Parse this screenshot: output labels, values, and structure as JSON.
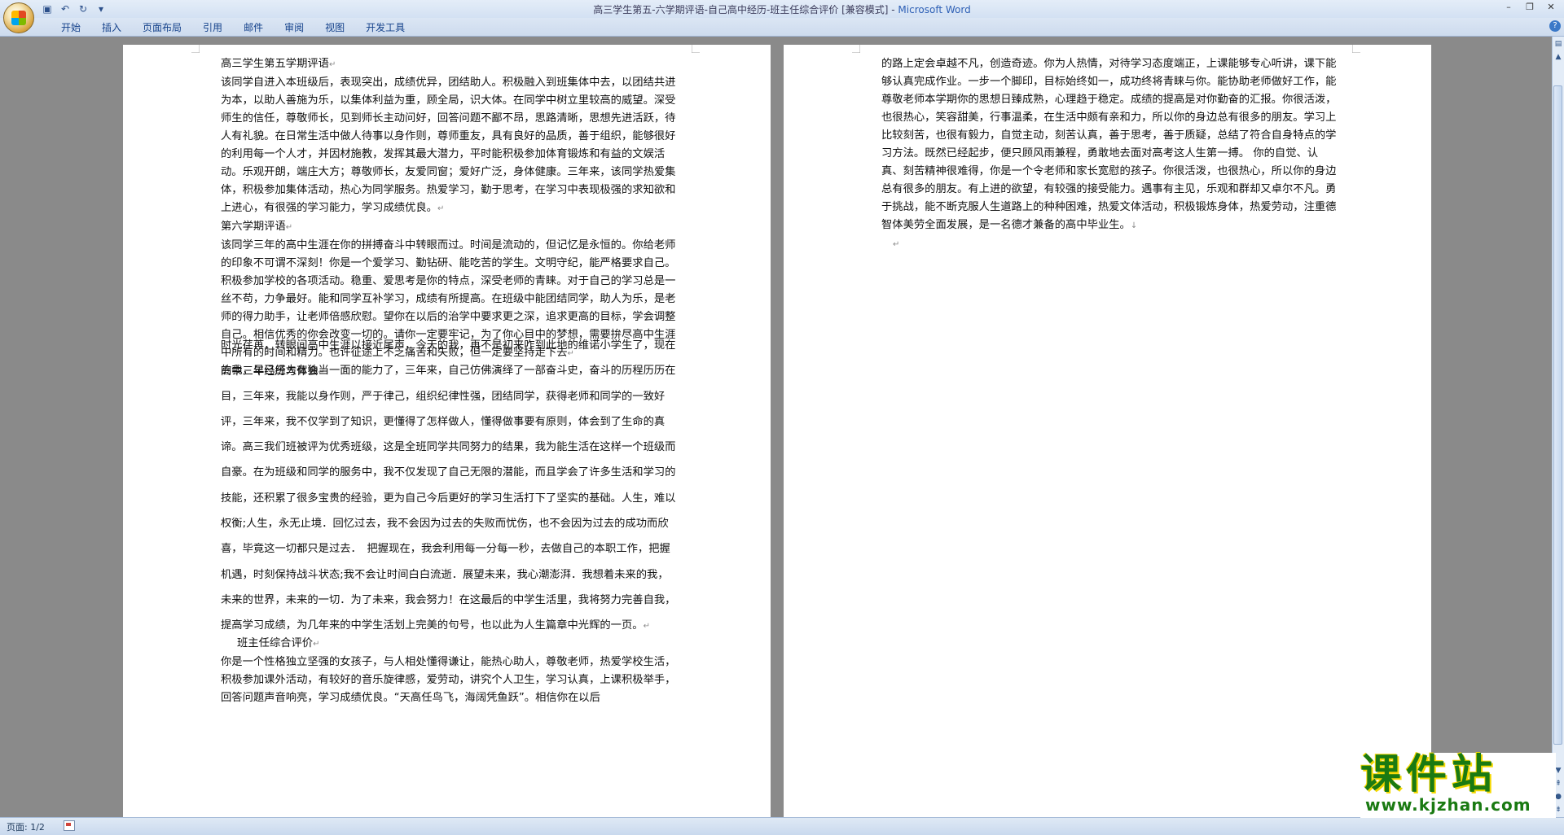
{
  "window": {
    "title": "高三学生第五-六学期评语-自己高中经历-班主任综合评价 [兼容模式] - ",
    "app_name": "Microsoft Word"
  },
  "ribbon": {
    "tabs": [
      "开始",
      "插入",
      "页面布局",
      "引用",
      "邮件",
      "审阅",
      "视图",
      "开发工具"
    ]
  },
  "page1": {
    "h1": "高三学生第五学期评语",
    "p1": "该同学自进入本班级后，表现突出，成绩优异，团结助人。积极融入到班集体中去，以团结共进为本，以助人善施为乐，以集体利益为重，顾全局，识大体。在同学中树立里较高的威望。深受师生的信任，尊敬师长，见到师长主动问好，回答问题不鄙不昂，思路清晰，思想先进活跃，待人有礼貌。在日常生活中做人待事以身作则，尊师重友，具有良好的品质，善于组织，能够很好的利用每一个人才，并因材施教，发挥其最大潜力，平时能积极参加体育锻炼和有益的文娱活动。乐观开朗，端庄大方；尊敬师长，友爱同窗；爱好广泛，身体健康。三年来，该同学热爱集体，积极参加集体活动，热心为同学服务。热爱学习，勤于思考，在学习中表现极强的求知欲和上进心，有很强的学习能力，学习成绩优良。",
    "h2": " 第六学期评语",
    "p2": "该同学三年的高中生涯在你的拼搏奋斗中转眼而过。时间是流动的，但记忆是永恒的。你给老师的印象不可谓不深刻！你是一个爱学习、勤钻研、能吃苦的学生。文明守纪，能严格要求自己。积极参加学校的各项活动。稳重、爱思考是你的特点，深受老师的青睐。对于自己的学习总是一丝不苟，力争最好。能和同学互补学习，成绩有所提高。在班级中能团结同学，助人为乐，是老师的得力助手，让老师倍感欣慰。望你在以后的治学中要求更之深，追求更高的目标，学会调整自己。相信优秀的你会改变一切的。请你一定要牢记，为了你心目中的梦想，需要拚尽高中生涯中所有的时间和精力。也许征途上不乏痛苦和失败，但一定要坚持走下去",
    "h3": " 高中三年经历与体会",
    "p3": "时光荏苒，转眼间高中生涯以接近尾声，今天的我，再不是初来咋到此地的维诺小学生了，现在的我，早已经大有独当一面的能力了，三年来，自己仿佛演绎了一部奋斗史，奋斗的历程历历在目，三年来，我能以身作则，严于律己，组织纪律性强，团结同学，获得老师和同学的一致好评，三年来，我不仅学到了知识，更懂得了怎样做人，懂得做事要有原则，体会到了生命的真谛。高三我们班被评为优秀班级，这是全班同学共同努力的结果，我为能生活在这样一个班级而自豪。在为班级和同学的服务中，我不仅发现了自己无限的潜能，而且学会了许多生活和学习的技能，还积累了很多宝贵的经验，更为自己今后更好的学习生活打下了坚实的基础。人生，难以权衡;人生，永无止境．回忆过去，我不会因为过去的失败而忧伤，也不会因为过去的成功而欣喜，毕竟这一切都只是过去．　把握现在，我会利用每一分每一秒，去做自己的本职工作，把握机遇，时刻保持战斗状态;我不会让时间白白流逝．展望未来，我心潮澎湃．我想着未来的我，未来的世界，未来的一切．为了未来，我会努力！在这最后的中学生活里，我将努力完善自我，提高学习成绩，为几年来的中学生活划上完美的句号，也以此为人生篇章中光辉的一页。",
    "h4": "班主任综合评价",
    "p4": "你是一个性格独立坚强的女孩子，与人相处懂得谦让，能热心助人，尊敬老师，热爱学校生活，积极参加课外活动，有较好的音乐旋律感，爱劳动，讲究个人卫生，学习认真，上课积极举手，回答问题声音响亮，学习成绩优良。“天高任鸟飞，海阔凭鱼跃”。相信你在以后"
  },
  "page2": {
    "p1": "的路上定会卓越不凡，创造奇迹。你为人热情，对待学习态度端正，上课能够专心听讲，课下能够认真完成作业。一步一个脚印，目标始终如一，成功终将青睐与你。能协助老师做好工作，能尊敬老师本学期你的思想日臻成熟，心理趋于稳定。成绩的提高是对你勤奋的汇报。你很活泼，也很热心，笑容甜美，行事温柔，在生活中颇有亲和力，所以你的身边总有很多的朋友。学习上比较刻苦，也很有毅力，自觉主动，刻苦认真，善于思考，善于质疑，总结了符合自身特点的学习方法。既然已经起步，便只顾风雨兼程，勇敢地去面对高考这人生第一搏。 你的自觉、认真、刻苦精神很难得，你是一个令老师和家长宽慰的孩子。你很活泼，也很热心，所以你的身边总有很多的朋友。有上进的欲望，有较强的接受能力。遇事有主见，乐观和群却又卓尔不凡。勇于挑战，能不断克服人生道路上的种种困难，热爱文体活动，积极锻炼身体，热爱劳动，注重德智体美劳全面发展，是一名德才兼备的高中毕业生。"
  },
  "marks": {
    "para": "↵",
    "down": "↓"
  },
  "status": {
    "page": "页面: 1/2"
  },
  "watermark": {
    "line1": "课件站",
    "line2": "www.kjzhan.com"
  }
}
